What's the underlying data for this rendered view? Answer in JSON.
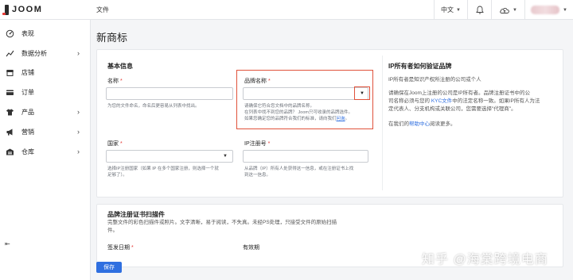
{
  "header": {
    "brand": "JOOM",
    "doc_link": "文件",
    "language": "中文",
    "icons": {
      "bell": "bell-icon",
      "cloud": "cloud-upload-icon"
    }
  },
  "sidebar": {
    "items": [
      {
        "label": "表现",
        "icon": "dashboard-icon",
        "chevron": false
      },
      {
        "label": "数据分析",
        "icon": "analytics-icon",
        "chevron": true
      },
      {
        "label": "店铺",
        "icon": "store-icon",
        "chevron": false
      },
      {
        "label": "订单",
        "icon": "orders-icon",
        "chevron": false
      },
      {
        "label": "产品",
        "icon": "products-icon",
        "chevron": true
      },
      {
        "label": "营销",
        "icon": "marketing-icon",
        "chevron": true
      },
      {
        "label": "仓库",
        "icon": "warehouse-icon",
        "chevron": true
      }
    ],
    "collapse_icon": "collapse-sidebar-icon"
  },
  "page": {
    "title": "新商标"
  },
  "basic_info": {
    "title": "基本信息",
    "name": {
      "label": "名称",
      "required": "*",
      "value": "",
      "hint": "为您的文件命名，命名后更容易从列表中找出。"
    },
    "brand_name": {
      "label": "品牌名称",
      "required": "*",
      "value": "",
      "hint1": "请确保它符合您文档中的品牌名称。",
      "hint2": "在列表中找不到您的品牌？ Joom只可收录的品牌选件。",
      "hint3_pre": "如果您确定您的品牌符合我们的标准，请向我们",
      "hint3_link": "问询",
      "hint3_post": "。"
    },
    "country": {
      "label": "国家",
      "required": "*",
      "value": "",
      "hint1": "选择IP注册国家（如果 IP 在多个国家注册，则选择一个就",
      "hint2": "足够了）。"
    },
    "ip_number": {
      "label": "IP注册号",
      "required": "*",
      "value": "",
      "hint1": "从品牌（IP）所有人处获得这一信息，或在注册证书上找",
      "hint2": "到这一信息。"
    }
  },
  "ip_owner": {
    "title": "IP所有者如何验证品牌",
    "p1": "IP所有者是知识产权所注册的公司或个人",
    "p2_1": "请确保在Joom上注册的公司是IP所有者。品牌注册证书中的公",
    "p2_2_pre": "司名称必须与您的 ",
    "p2_2_link": "KYC文件",
    "p2_2_post": "中的法定名称一致。如果IP所有人为法",
    "p2_3": "定代表人、分支机构或关联公司，您需要选择\"代理商\"。",
    "p3_pre": "在我们的",
    "p3_link": "帮助中心",
    "p3_post": "阅读更多。"
  },
  "scan": {
    "title": "品牌注册证书扫描件",
    "desc1": "完整文件的彩色扫描件或照片。文字清晰，易于阅读，不失真。未经PS处理，只接受文件的原始扫描",
    "desc2": "件。",
    "issue_date": {
      "label": "签发日期",
      "required": "*"
    },
    "validity": {
      "label": "有效期"
    }
  },
  "actions": {
    "save": "保存"
  },
  "watermark": "知乎 @海棠跨境电商"
}
